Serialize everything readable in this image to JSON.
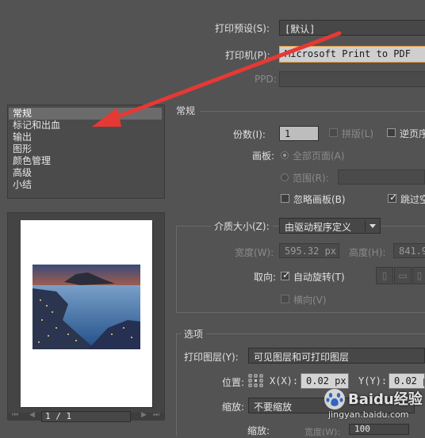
{
  "top": {
    "preset_label": "打印预设(S):",
    "preset_value": "[默认]",
    "printer_label": "打印机(P):",
    "printer_value": "Microsoft Print to PDF",
    "ppd_label": "PPD:"
  },
  "sidebar": {
    "items": [
      {
        "label": "常规"
      },
      {
        "label": "标记和出血"
      },
      {
        "label": "输出"
      },
      {
        "label": "图形"
      },
      {
        "label": "颜色管理"
      },
      {
        "label": "高级"
      },
      {
        "label": "小结"
      }
    ],
    "page_indicator": "1 / 1"
  },
  "general": {
    "title": "常规",
    "copies_label": "份数(I):",
    "copies_value": "1",
    "collate_label": "拼版(L)",
    "reverse_label": "逆页序",
    "artboard_label": "画板:",
    "all_pages_label": "全部页面(A)",
    "range_label": "范围(R):",
    "ignore_artboards_label": "忽略画板(B)",
    "skip_blank_label": "跳过空白"
  },
  "media": {
    "size_label": "介质大小(Z):",
    "size_value": "由驱动程序定义",
    "width_label": "宽度(W):",
    "width_value": "595.32 px",
    "height_label": "高度(H):",
    "height_value": "841.9",
    "orientation_label": "取向:",
    "auto_rotate_label": "自动旋转(T)",
    "landscape_label": "横向(V)"
  },
  "options": {
    "title": "选项",
    "print_layers_label": "打印图层(Y):",
    "print_layers_value": "可见图层和可打印图层",
    "position_label": "位置:",
    "x_label": "X(X):",
    "x_value": "0.02 px",
    "y_label": "Y(Y):",
    "y_value": "0.02 p",
    "scaling_label": "缩放:",
    "scaling_value": "不要缩放",
    "scale_label": "缩放:",
    "scale_width_label": "宽度(W):",
    "scale_width_value": "100"
  },
  "watermark": {
    "brand": "Baidu经验",
    "url": "jingyan.baidu.com"
  },
  "colors": {
    "annotation_arrow": "#e53935",
    "printer_highlight": "#e8a040"
  }
}
